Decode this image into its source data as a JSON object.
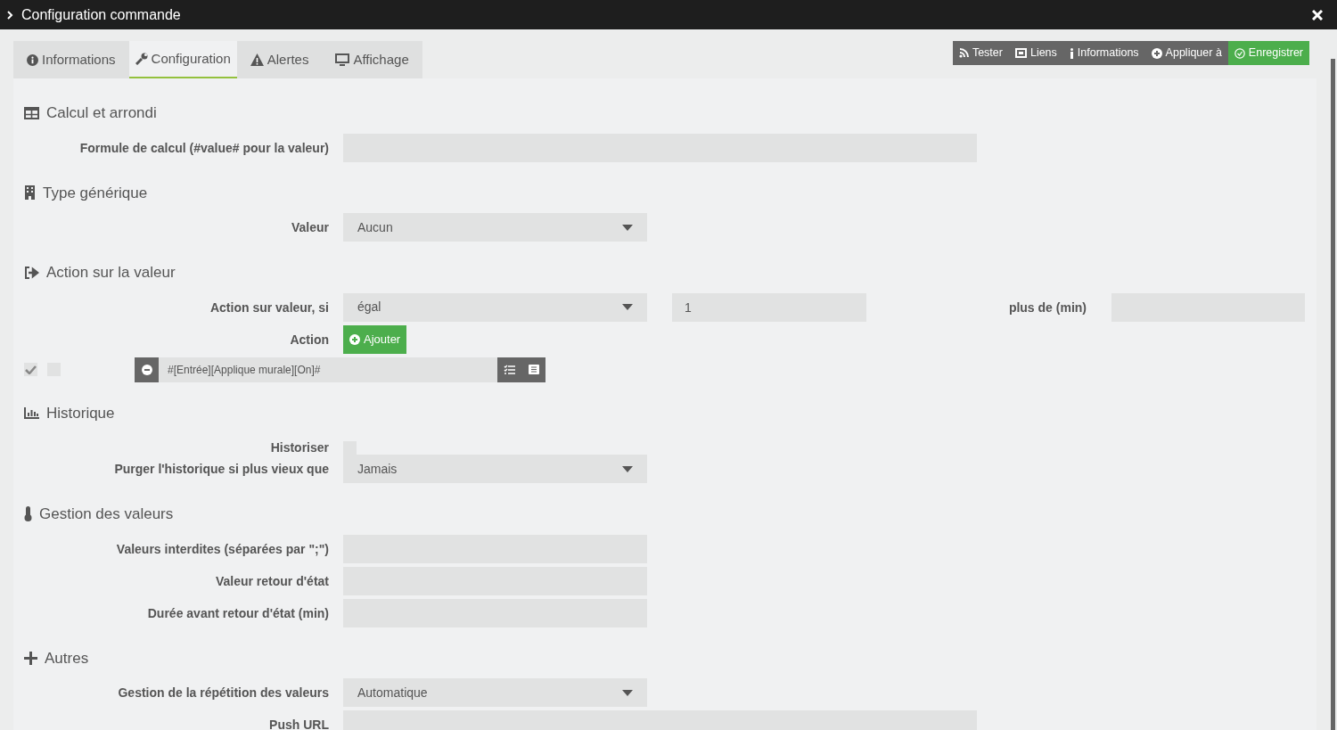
{
  "window": {
    "title": "Configuration commande"
  },
  "tabs": [
    {
      "label": "Informations",
      "selected": false
    },
    {
      "label": "Configuration",
      "selected": true
    },
    {
      "label": "Alertes",
      "selected": false
    },
    {
      "label": "Affichage",
      "selected": false
    }
  ],
  "toolbar": [
    {
      "label": "Tester",
      "kind": "plain"
    },
    {
      "label": "Liens",
      "kind": "plain"
    },
    {
      "label": "Informations",
      "kind": "plain"
    },
    {
      "label": "Appliquer à",
      "kind": "plain"
    },
    {
      "label": "Enregistrer",
      "kind": "primary"
    }
  ],
  "sections": [
    {
      "title": "Calcul et arrondi",
      "rows": [
        {
          "kind": "long_input",
          "label": "Formule de calcul (#value# pour la valeur)"
        }
      ]
    },
    {
      "title": "Type générique",
      "rows": [
        {
          "kind": "select",
          "label": "Valeur",
          "value": "Aucun"
        }
      ]
    },
    {
      "title": "Action sur la valeur",
      "rows": [
        {
          "kind": "condition",
          "label": "Action sur valeur, si",
          "value": "égal",
          "operand": "1",
          "label2": "plus de (min)"
        },
        {
          "kind": "button",
          "label": "Action",
          "button": "Ajouter"
        },
        {
          "kind": "action",
          "checked": true,
          "enabled": false,
          "value": "#[Entrée][Applique murale][On]#"
        }
      ]
    },
    {
      "title": "Historique",
      "rows": [
        {
          "kind": "checkbox",
          "label": "Historiser",
          "checked": false
        },
        {
          "kind": "select",
          "label": "Purger l'historique si plus vieux que",
          "value": "Jamais"
        }
      ]
    },
    {
      "title": "Gestion des valeurs",
      "rows": [
        {
          "kind": "input",
          "label": "Valeurs interdites (séparées par \";\")"
        },
        {
          "kind": "input",
          "label": "Valeur retour d'état"
        },
        {
          "kind": "input",
          "label": "Durée avant retour d'état (min)"
        }
      ]
    },
    {
      "title": "Autres",
      "rows": [
        {
          "kind": "select",
          "label": "Gestion de la répétition des valeurs",
          "value": "Automatique"
        },
        {
          "kind": "long_input",
          "label": "Push URL"
        }
      ]
    }
  ]
}
